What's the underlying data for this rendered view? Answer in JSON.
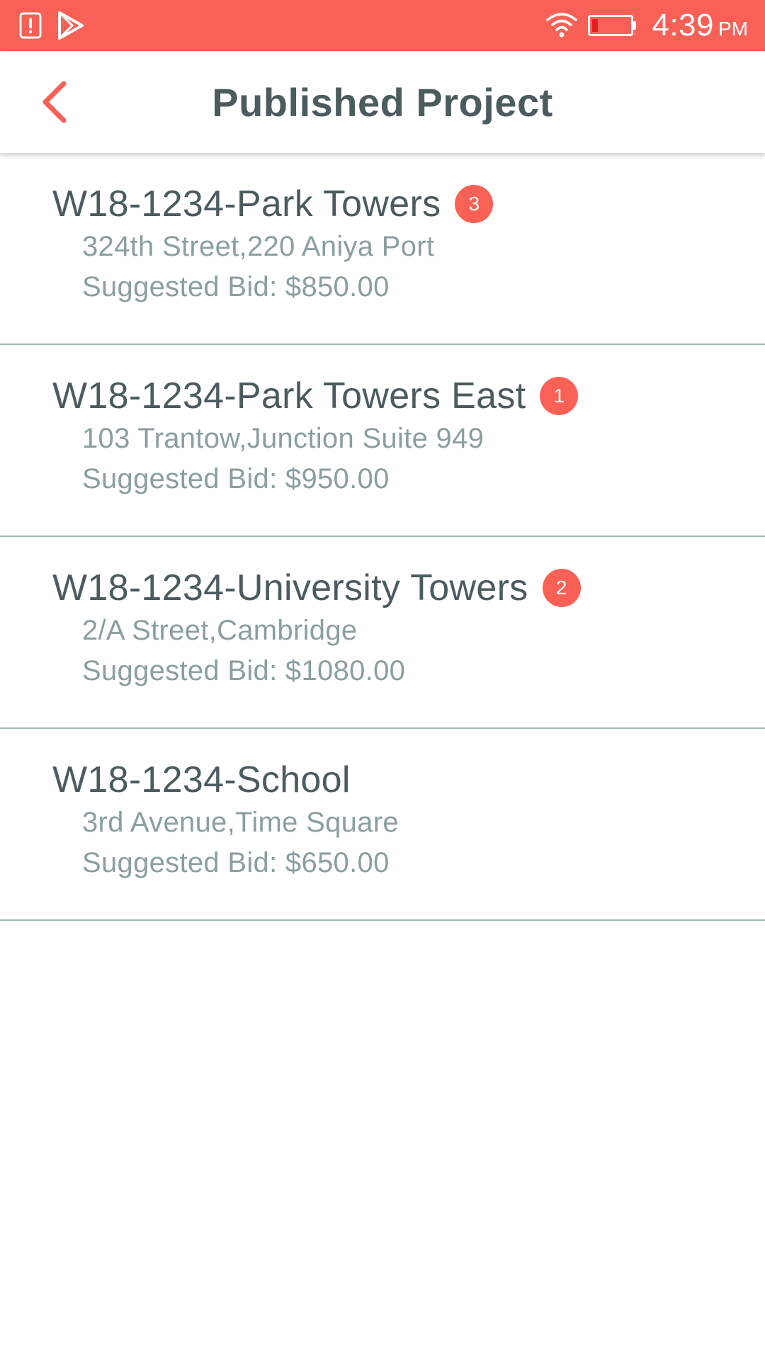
{
  "status_bar": {
    "time": "4:39",
    "ampm": "PM",
    "battery_level": 0.15,
    "icons": [
      "alert-icon",
      "play-store-icon",
      "wifi-icon",
      "battery-icon"
    ],
    "accent_color": "#f96157"
  },
  "header": {
    "title": "Published Project",
    "back_icon": "chevron-left-icon"
  },
  "projects": [
    {
      "title": "W18-1234-Park Towers",
      "badge": "3",
      "address": "324th Street,220 Aniya Port",
      "bid": "Suggested Bid: $850.00"
    },
    {
      "title": "W18-1234-Park Towers East",
      "badge": "1",
      "address": "103 Trantow,Junction Suite 949",
      "bid": "Suggested Bid: $950.00"
    },
    {
      "title": "W18-1234-University Towers",
      "badge": "2",
      "address": "2/A Street,Cambridge",
      "bid": "Suggested Bid: $1080.00"
    },
    {
      "title": "W18-1234-School",
      "badge": "",
      "address": "3rd Avenue,Time Square",
      "bid": "Suggested Bid: $650.00"
    }
  ]
}
